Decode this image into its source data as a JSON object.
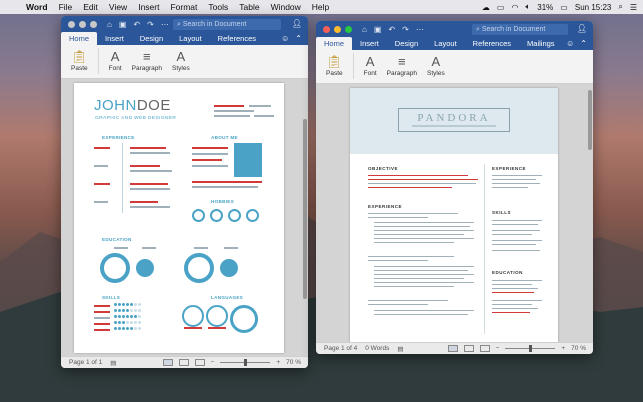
{
  "menubar": {
    "app": "Word",
    "menus": [
      "File",
      "Edit",
      "View",
      "Insert",
      "Format",
      "Tools",
      "Table",
      "Window",
      "Help"
    ],
    "battery": "31%",
    "clock": "Sun 15:23"
  },
  "left_window": {
    "search_placeholder": "Search in Document",
    "tabs": [
      "Home",
      "Insert",
      "Design",
      "Layout",
      "References"
    ],
    "ribbon": [
      "Paste",
      "Font",
      "Paragraph",
      "Styles"
    ],
    "status": {
      "page": "Page 1 of 1",
      "zoom": "70 %"
    },
    "resume": {
      "name_first": "JOHN",
      "name_last": "DOE",
      "subtitle": "GRAPHIC AND WEB DESIGNER",
      "sections": {
        "experience": "EXPERIENCE",
        "about": "ABOUT ME",
        "hobbies": "HOBBIES",
        "education": "EDUCATION",
        "skills": "SKILLS",
        "languages": "LANGUAGES"
      }
    }
  },
  "right_window": {
    "search_placeholder": "Search in Document",
    "tabs": [
      "Home",
      "Insert",
      "Design",
      "Layout",
      "References",
      "Mailings"
    ],
    "ribbon": [
      "Paste",
      "Font",
      "Paragraph",
      "Styles"
    ],
    "status": {
      "page": "Page 1 of 4",
      "words": "0 Words",
      "zoom": "70 %"
    },
    "resume": {
      "name": "PANDORA",
      "sections": {
        "objective": "OBJECTIVE",
        "experience_main": "EXPERIENCE",
        "experience_side": "EXPERIENCE",
        "skills": "SKILLS",
        "education": "EDUCATION"
      }
    }
  },
  "colors": {
    "word_blue": "#2b579a",
    "resume_teal": "#4aa3c6",
    "spell_red": "#d23a3a"
  }
}
